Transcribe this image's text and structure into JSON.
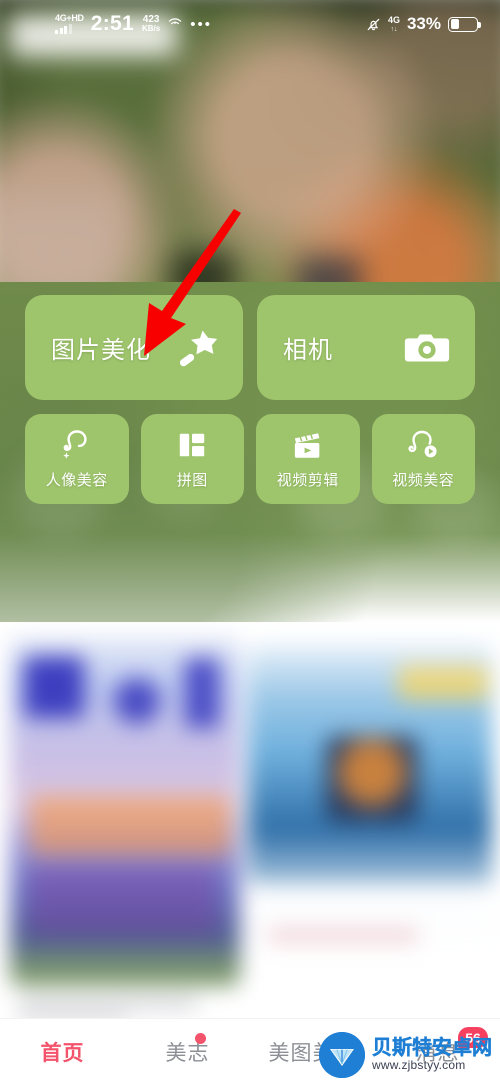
{
  "status_bar": {
    "network_label": "4G+HD",
    "signal_bars": 4,
    "time": "2:51",
    "net_speed_value": "423",
    "net_speed_unit": "KB/s",
    "wifi_icon": "wifi-hotspot-icon",
    "more_icon": "more-dots-icon",
    "mute_icon": "bell-mute-icon",
    "network_label_right": "4G",
    "network_sub_right": "↑↓",
    "battery_percent": "33%",
    "battery_level": 33
  },
  "action_panel": {
    "primary_tiles": [
      {
        "label": "图片美化",
        "icon": "magic-wand-star-icon"
      },
      {
        "label": "相机",
        "icon": "camera-icon"
      }
    ],
    "secondary_tiles": [
      {
        "label": "人像美容",
        "icon": "portrait-beauty-icon"
      },
      {
        "label": "拼图",
        "icon": "collage-grid-icon"
      },
      {
        "label": "视频剪辑",
        "icon": "video-clapper-play-icon"
      },
      {
        "label": "视频美容",
        "icon": "video-portrait-play-icon"
      }
    ],
    "tile_color": "#9ec46c",
    "panel_color": "#6f8a4a"
  },
  "bottom_nav": {
    "tabs": [
      {
        "label": "首页",
        "active": true,
        "dot": false,
        "badge": ""
      },
      {
        "label": "美志",
        "active": false,
        "dot": true,
        "badge": ""
      },
      {
        "label": "美图美学",
        "active": false,
        "dot": false,
        "badge": ""
      },
      {
        "label": "消息",
        "active": false,
        "dot": false,
        "badge": "56"
      }
    ],
    "active_color": "#f3536b",
    "inactive_color": "#8d8f96",
    "badge_color": "#f5415f"
  },
  "watermark": {
    "name": "贝斯特安卓网",
    "url": "www.zjbstyy.com",
    "brand_color": "#1e7fd4"
  },
  "annotation": {
    "arrow_color": "#f80000",
    "points_to": "图片美化"
  }
}
